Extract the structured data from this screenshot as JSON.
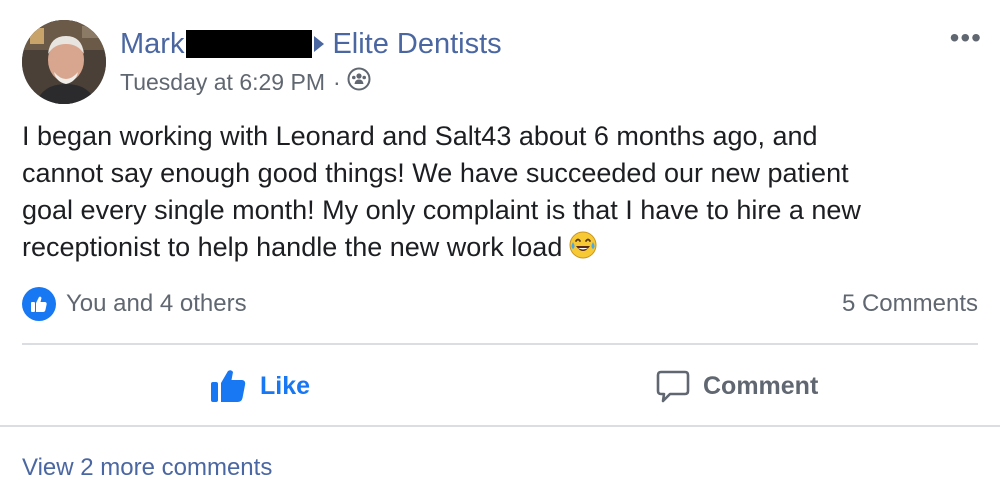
{
  "post": {
    "author_name": "Mark",
    "group_name": "Elite Dentists",
    "timestamp": "Tuesday at 6:29 PM",
    "separator": "·",
    "privacy_icon": "group-audience-icon",
    "more_label": "•••",
    "text_lines": [
      "I began working with Leonard and Salt43 about 6 months ago, and",
      "cannot say enough good things! We have succeeded our new patient",
      "goal every single month! My only complaint is that I have to hire a new",
      "receptionist to help handle the new work load"
    ],
    "emoji": "face-with-tears-of-joy"
  },
  "reactions": {
    "summary": "You and 4 others",
    "comments_count": "5 Comments",
    "badge_icon": "thumbs-up-icon",
    "badge_color": "#1877f2"
  },
  "actions": {
    "like_label": "Like",
    "comment_label": "Comment"
  },
  "comments": {
    "view_more_label": "View 2 more comments"
  },
  "colors": {
    "link": "#4b67a1",
    "accent": "#1877f2",
    "muted": "#606770"
  }
}
